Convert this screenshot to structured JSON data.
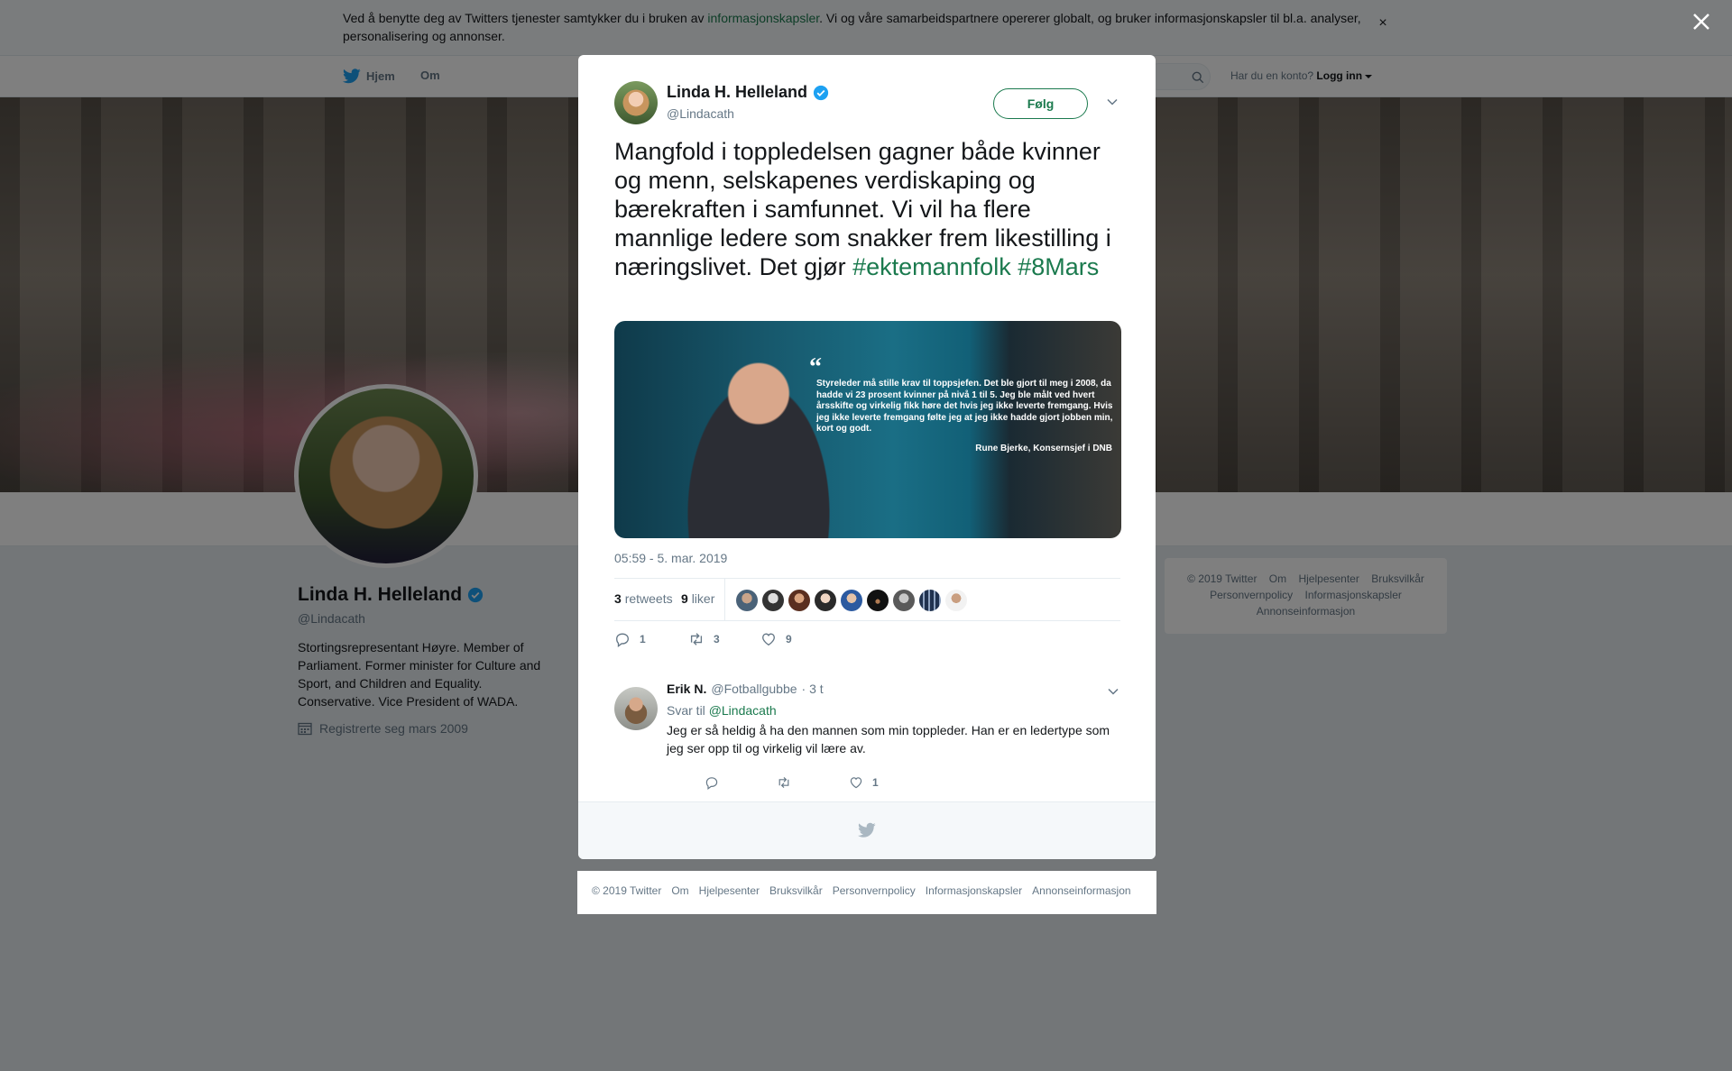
{
  "cookie": {
    "text_before": "Ved å benytte deg av Twitters tjenester samtykker du i bruken av ",
    "link": "informasjonskapsler",
    "text_after": ". Vi og våre samarbeidspartnere opererer globalt, og bruker informasjonskapsler til bl.a. analyser, personalisering og annonser.",
    "close_glyph": "×"
  },
  "nav": {
    "home": "Hjem",
    "about": "Om",
    "login_prompt": "Har du en konto?",
    "login": "Logg inn"
  },
  "profile": {
    "name": "Linda H. Helleland",
    "handle": "@Lindacath",
    "bio": "Stortingsrepresentant Høyre. Member of Parliament. Former minister for Culture and Sport, and Children and Equality. Conservative. Vice President of WADA.",
    "joined": "Registrerte seg mars 2009"
  },
  "side_footer": {
    "items": [
      "© 2019 Twitter",
      "Om",
      "Hjelpesenter",
      "Bruksvilkår",
      "Personvernpolicy",
      "Informasjonskapsler",
      "Annonseinformasjon"
    ]
  },
  "tweet": {
    "name": "Linda H. Helleland",
    "handle": "@Lindacath",
    "follow_label": "Følg",
    "text": "Mangfold i toppledelsen gagner både kvinner og menn, selskapenes verdiskaping og bærekraften i samfunnet. Vi vil ha flere mannlige ledere som snakker frem likestilling i næringslivet. Det gjør ",
    "hashtag1": "#ektemannfolk",
    "hashtag2": "#8Mars",
    "media": {
      "quote_mark": "“",
      "quote": "Styreleder må stille krav til toppsjefen. Det ble gjort til meg i 2008, da hadde vi 23 prosent kvinner på nivå 1 til 5. Jeg ble målt ved hvert årsskifte og virkelig fikk høre det hvis jeg ikke leverte fremgang. Hvis jeg ikke leverte fremgang følte jeg at jeg ikke hadde gjort jobben min, kort og godt.",
      "credit": "Rune Bjerke, Konsernsjef i DNB"
    },
    "timestamp": "05:59 - 5. mar. 2019",
    "retweets_count": "3",
    "retweets_label": "retweets",
    "likes_count": "9",
    "likes_label": "liker",
    "reply_count": "1",
    "retweet_count": "3",
    "like_count": "9"
  },
  "reply": {
    "name": "Erik N.",
    "handle": "@Fotballgubbe",
    "time": "· 3 t",
    "reply_to_prefix": "Svar til",
    "reply_to_handle": "@Lindacath",
    "text": "Jeg er så heldig å ha den mannen som min toppleder. Han er en ledertype som jeg ser opp til og virkelig vil lære av.",
    "like_count": "1"
  },
  "bottom_footer": {
    "items": [
      "© 2019 Twitter",
      "Om",
      "Hjelpesenter",
      "Bruksvilkår",
      "Personvernpolicy",
      "Informasjonskapsler",
      "Annonseinformasjon"
    ]
  },
  "colors": {
    "accent": "#1b7a4e",
    "verified": "#1da1f2",
    "secondary_text": "#657786"
  }
}
